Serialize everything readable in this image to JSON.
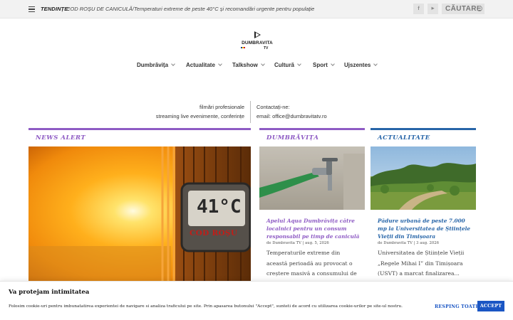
{
  "topbar": {
    "trending_label": "TENDINȚE:",
    "trending_text": "COD ROȘU DE CANICULĂ/Temperaturi extreme de peste 40°C și recomandări urgente pentru populație",
    "social": [
      {
        "icon": "facebook-icon",
        "glyph": "f"
      },
      {
        "icon": "youtube-icon",
        "glyph": "▶"
      }
    ],
    "search_label": "CĂUTARE"
  },
  "logo": {
    "name": "DUMBRAVITA",
    "suffix": "TV"
  },
  "nav": [
    {
      "label": "Dumbrăvița"
    },
    {
      "label": "Actualitate"
    },
    {
      "label": "Talkshow"
    },
    {
      "label": "Cultură"
    },
    {
      "label": "Sport"
    },
    {
      "label": "Ujszentes"
    }
  ],
  "info": {
    "left": [
      "filmări profesionale",
      "streaming live evenimente, conferințe"
    ],
    "right": [
      "Contactați-ne:",
      "email: office@dumbravitatv.ro"
    ]
  },
  "sections": {
    "news_alert": {
      "title": "NEWS ALERT",
      "color": "#8e5bc4",
      "image_text": "COD ROȘU",
      "image_temp": "41°C"
    },
    "dumbravita": {
      "title": "DUMBRĂVIȚA",
      "color": "#8e5bc4",
      "card_title": "Apelul Aqua Dumbrăvița către localnici pentru un consum responsabil pe timp de caniculă",
      "meta": "de Dumbravita TV | aug. 5, 2026",
      "excerpt": "Temperaturile extreme din această perioadă au provocat o creștere masivă a consumului de apă..."
    },
    "actualitate": {
      "title": "ACTUALITATE",
      "color": "#2765a8",
      "card_title": "Pădure urbană de peste 7.000 mp la Universitatea de Științele Vieții din Timișoara",
      "meta": "de Dumbravita TV | 3 aug. 2026",
      "excerpt": "Universitatea de Științele Vieții „Regele Mihai I” din Timișoara (USVT) a marcat finalizarea..."
    }
  },
  "cookie": {
    "title": "Va protejam intimitatea",
    "text": "Folosim cookie-uri pentru imbunatatirea experientei de navigare si analiza traficului pe site. Prin apasarea butonului \"Accept\", sunteti de acord cu utilizarea cookie-urilor pe site-ul nostru.",
    "reject": "RESPING TOATE",
    "accept": "ACCEPT"
  },
  "colors": {
    "accent_purple": "#8e5bc4",
    "accent_blue": "#2765a8",
    "button_blue": "#1a56c4"
  }
}
